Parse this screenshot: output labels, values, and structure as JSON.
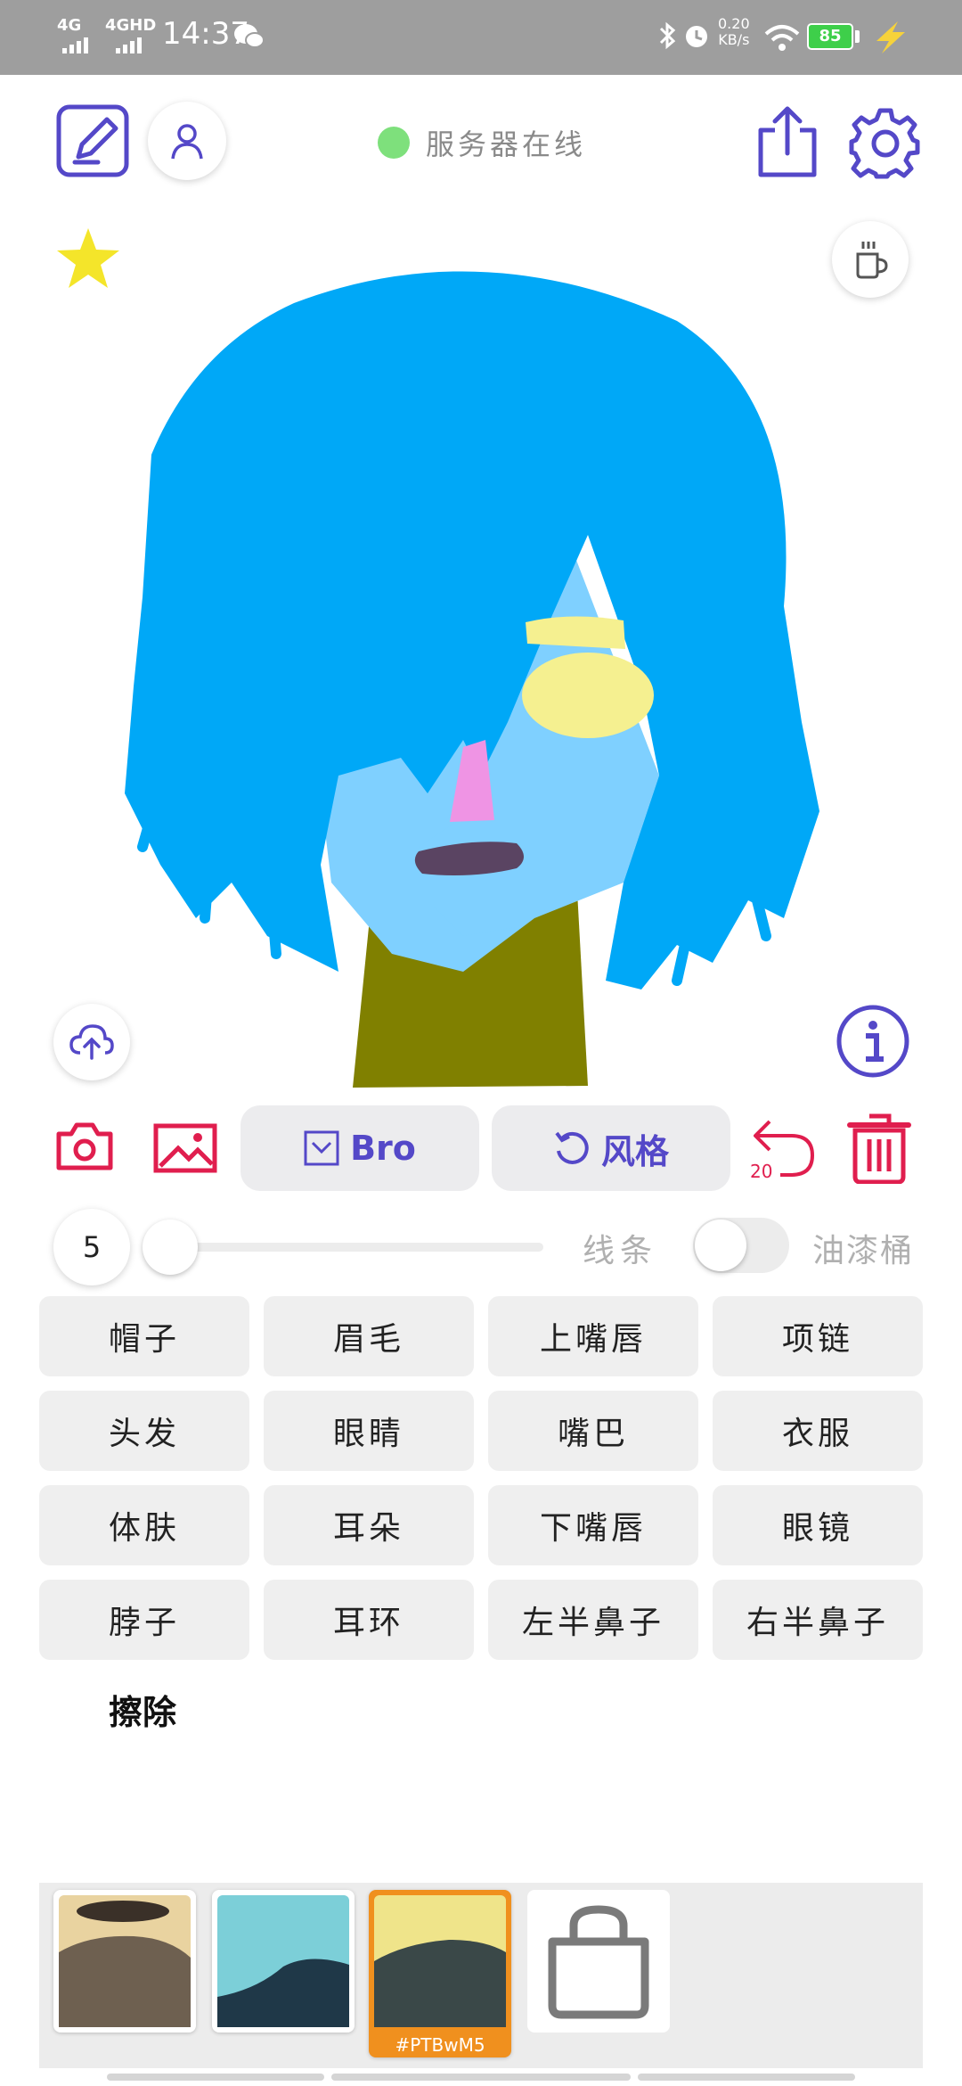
{
  "status_bar": {
    "net1": "4G",
    "net2": "4GHD",
    "time": "14:37",
    "speed_value": "0.20",
    "speed_unit": "KB/s",
    "battery": "85"
  },
  "header": {
    "server_status": "服务器在线",
    "status_color": "#7ee07c",
    "accent_color": "#5448c8"
  },
  "toolbar": {
    "model_label": "Bro",
    "style_label": "风格",
    "undo_count": "20",
    "action_color": "#e01e4e"
  },
  "brush": {
    "size": "5",
    "line_label": "线条",
    "bucket_label": "油漆桶"
  },
  "parts": [
    "帽子",
    "眉毛",
    "上嘴唇",
    "项链",
    "头发",
    "眼睛",
    "嘴巴",
    "衣服",
    "体肤",
    "耳朵",
    "下嘴唇",
    "眼镜",
    "脖子",
    "耳环",
    "左半鼻子",
    "右半鼻子"
  ],
  "erase_label": "擦除",
  "gallery": {
    "selected_tag": "#PTBwM5"
  }
}
